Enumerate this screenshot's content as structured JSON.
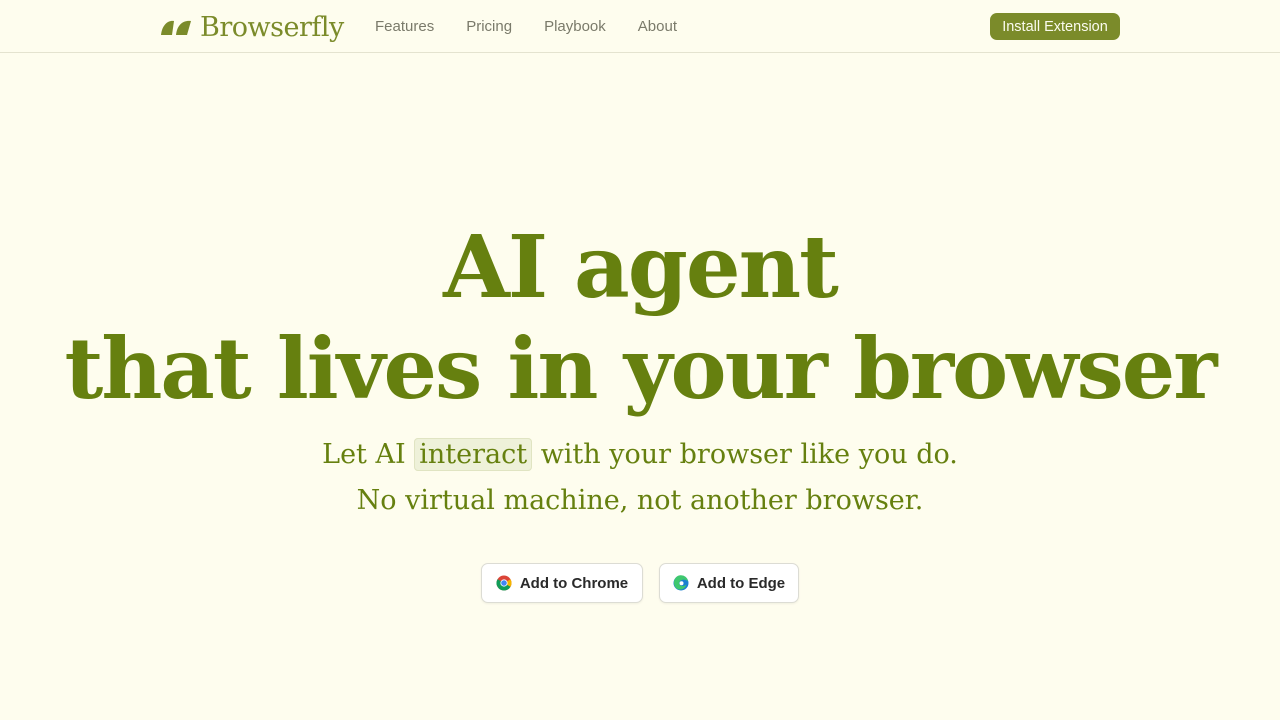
{
  "brand": {
    "name": "Browserfly",
    "logo_icon": "browserfly-logo-icon",
    "accent": "#7b8b2a"
  },
  "nav": {
    "links": [
      {
        "label": "Features"
      },
      {
        "label": "Pricing"
      },
      {
        "label": "Playbook"
      },
      {
        "label": "About"
      }
    ],
    "cta_label": "Install Extension"
  },
  "hero": {
    "line1": "AI agent",
    "line2": "that lives in your browser",
    "sub1_prefix": "Let AI",
    "sub1_highlight": "interact",
    "sub1_suffix": "with your browser like you do.",
    "sub2": "No virtual machine, not another browser.",
    "text_color": "#66800f"
  },
  "actions": {
    "chrome_label": "Add to Chrome",
    "chrome_icon": "chrome-icon",
    "edge_label": "Add to Edge",
    "edge_icon": "edge-icon"
  },
  "background": "#fefdee"
}
